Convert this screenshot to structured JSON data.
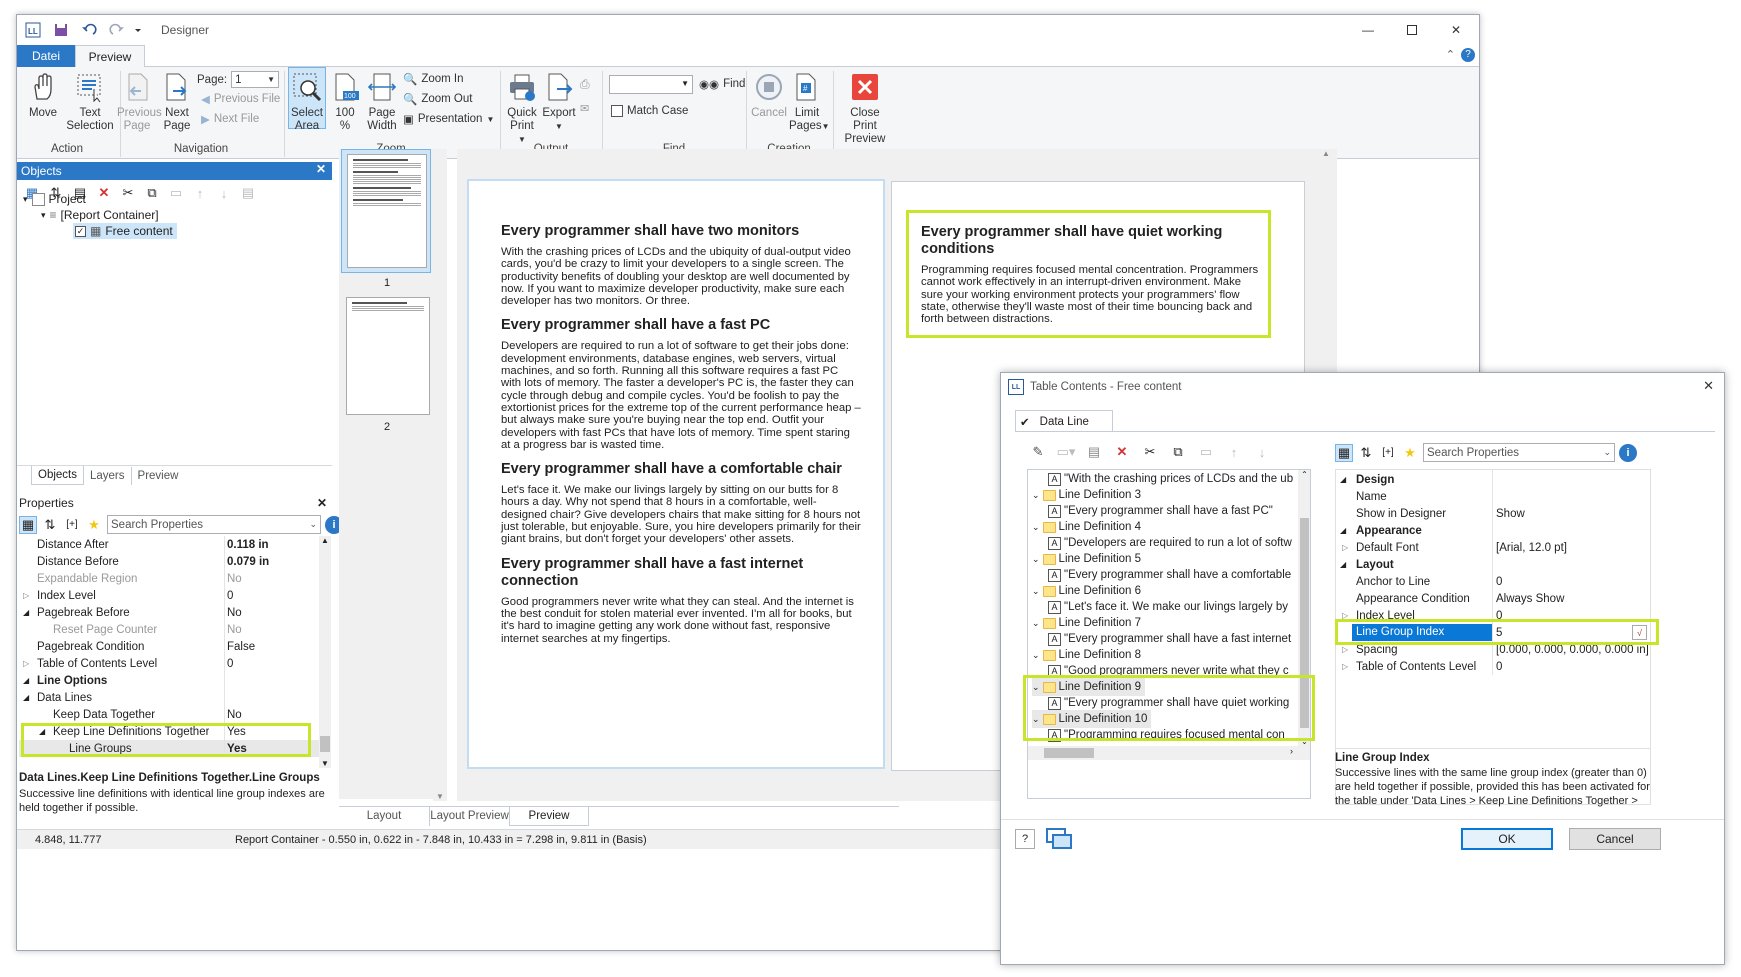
{
  "window": {
    "title": "Designer"
  },
  "tabs": {
    "file": "Datei",
    "preview": "Preview"
  },
  "ribbon": {
    "move": "Move",
    "text_selection_1": "Text",
    "text_selection_2": "Selection",
    "previous_page_1": "Previous",
    "previous_page_2": "Page",
    "next_page_1": "Next",
    "next_page_2": "Page",
    "page_label": "Page:",
    "page_value": "1",
    "previous_file": "Previous File",
    "next_file": "Next File",
    "select_area_1": "Select",
    "select_area_2": "Area",
    "zoom_100_1": "100",
    "zoom_100_2": "%",
    "page_width_1": "Page",
    "page_width_2": "Width",
    "zoom_in": "Zoom In",
    "zoom_out": "Zoom Out",
    "presentation": "Presentation",
    "quick_print_1": "Quick",
    "quick_print_2": "Print",
    "export": "Export",
    "find": "Find",
    "match_case": "Match Case",
    "cancel": "Cancel",
    "limit_pages_1": "Limit",
    "limit_pages_2": "Pages",
    "close_preview_1": "Close Print",
    "close_preview_2": "Preview",
    "groups": {
      "action": "Action",
      "navigation": "Navigation",
      "zoom": "Zoom",
      "output": "Output",
      "find": "Find",
      "creation": "Creation"
    }
  },
  "objects_panel": {
    "title": "Objects",
    "tree": {
      "project": "Project",
      "container": "[Report Container]",
      "free_content": "Free content"
    },
    "bottom_tabs": {
      "objects": "Objects",
      "layers": "Layers",
      "preview": "Preview"
    }
  },
  "properties": {
    "title": "Properties",
    "search_placeholder": "Search Properties",
    "rows": [
      {
        "name": "Distance After",
        "value": "0.118 in"
      },
      {
        "name": "Distance Before",
        "value": "0.079 in"
      },
      {
        "name": "Expandable Region",
        "value": "No"
      },
      {
        "name": "Index Level",
        "value": "0"
      },
      {
        "name": "Pagebreak Before",
        "value": "No"
      },
      {
        "name": "Reset Page Counter",
        "value": "No"
      },
      {
        "name": "Pagebreak Condition",
        "value": "False"
      },
      {
        "name": "Table of Contents Level",
        "value": "0"
      },
      {
        "name": "Line Options",
        "value": ""
      },
      {
        "name": "Data Lines",
        "value": ""
      },
      {
        "name": "Keep Data Together",
        "value": "No"
      },
      {
        "name": "Keep Line Definitions Together",
        "value": "Yes"
      },
      {
        "name": "Line Groups",
        "value": "Yes"
      }
    ],
    "help_title": "Data Lines.Keep Line Definitions Together.Line Groups",
    "help_text": "Successive line definitions with identical line group indexes are held together if possible."
  },
  "thumbnails": {
    "page1": "1",
    "page2": "2"
  },
  "preview_tabs": {
    "layout": "Layout",
    "layout_preview": "Layout Preview",
    "preview": "Preview"
  },
  "document": {
    "page1": [
      {
        "heading": "Every programmer shall have two monitors",
        "text": "With the crashing prices of LCDs and the ubiquity of dual-output video cards, you'd be crazy to limit your developers to a single screen. The productivity benefits of doubling your desktop are well documented by now. If you want to maximize developer productivity, make sure each developer has two monitors. Or three."
      },
      {
        "heading": "Every programmer shall have a fast PC",
        "text": "Developers are required to run a lot of software to get their jobs done: development environments, database engines, web servers, virtual machines, and so forth. Running all this software requires a fast PC with lots of memory. The faster a developer's PC is, the faster they can cycle through debug and compile cycles. You'd be foolish to pay the extortionist prices for the extreme top of the current performance heap – but always make sure you're buying near the top end. Outfit your developers with fast PCs that have lots of memory. Time spent staring at a progress bar is wasted time."
      },
      {
        "heading": "Every programmer shall have a comfortable chair",
        "text": "Let's face it. We make our livings largely by sitting on our butts for 8 hours a day. Why not spend that 8 hours in a comfortable, well-designed chair? Give developers chairs that make sitting for 8 hours not just tolerable, but enjoyable. Sure, you hire developers primarily for their giant brains, but don't forget your developers' other assets."
      },
      {
        "heading": "Every programmer shall have a fast internet connection",
        "text": "Good programmers never write what they can steal. And the internet is the best conduit for stolen material ever invented. I'm all for books, but it's hard to imagine getting any work done without fast, responsive internet searches at my fingertips."
      }
    ],
    "page2": {
      "heading": "Every programmer shall have quiet working conditions",
      "text": "Programming requires focused mental concentration. Programmers cannot work effectively in an interrupt-driven environment. Make sure your working environment protects your programmers' flow state, otherwise they'll waste most of their time bouncing back and forth between distractions."
    }
  },
  "status_bar": {
    "coords": "4.848, 11.777",
    "info": "Report Container  -  0.550 in, 0.622 in  -  7.848 in, 10.433 in  =  7.298 in, 9.811 in (Basis)"
  },
  "dialog": {
    "title": "Table Contents - Free content",
    "tab": "Data Line",
    "tree": [
      {
        "type": "text",
        "label": "\"With the crashing prices of LCDs and the ub"
      },
      {
        "type": "def",
        "label": "Line Definition  3"
      },
      {
        "type": "text",
        "label": "\"Every programmer shall have a fast PC\""
      },
      {
        "type": "def",
        "label": "Line Definition  4"
      },
      {
        "type": "text",
        "label": "\"Developers are required to run a lot of softw"
      },
      {
        "type": "def",
        "label": "Line Definition  5"
      },
      {
        "type": "text",
        "label": "\"Every programmer shall have a comfortable"
      },
      {
        "type": "def",
        "label": "Line Definition  6"
      },
      {
        "type": "text",
        "label": "\"Let's face it. We make our livings largely by"
      },
      {
        "type": "def",
        "label": "Line Definition  7"
      },
      {
        "type": "text",
        "label": "\"Every programmer shall have a fast internet"
      },
      {
        "type": "def",
        "label": "Line Definition  8"
      },
      {
        "type": "text",
        "label": "\"Good programmers never write what they c"
      },
      {
        "type": "def",
        "label": "Line Definition  9"
      },
      {
        "type": "text",
        "label": "\"Every programmer shall have quiet working"
      },
      {
        "type": "def",
        "label": "Line Definition 10"
      },
      {
        "type": "text",
        "label": "\"Programming requires focused mental con"
      }
    ],
    "search_placeholder": "Search Properties",
    "props": [
      {
        "name": "Design",
        "value": "",
        "cat": true
      },
      {
        "name": "Name",
        "value": ""
      },
      {
        "name": "Show in Designer",
        "value": "Show"
      },
      {
        "name": "Appearance",
        "value": "",
        "cat": true
      },
      {
        "name": "Default Font",
        "value": "[Arial, 12.0 pt]"
      },
      {
        "name": "Layout",
        "value": "",
        "cat": true
      },
      {
        "name": "Anchor to Line",
        "value": "0"
      },
      {
        "name": "Appearance Condition",
        "value": "Always Show"
      },
      {
        "name": "Index Level",
        "value": "0"
      },
      {
        "name": "Line Group Index",
        "value": "5"
      },
      {
        "name": "Spacing",
        "value": "[0.000, 0.000, 0.000, 0.000 in]"
      },
      {
        "name": "Table of Contents Level",
        "value": "0"
      }
    ],
    "help_title": "Line Group Index",
    "help_text": "Successive lines with the same line group index (greater than 0) are held together if possible, provided this has been activated for the table under 'Data Lines > Keep Line Definitions Together >",
    "ok": "OK",
    "cancel": "Cancel"
  },
  "colors": {
    "accent": "#2b78c6",
    "highlight": "#c8e629",
    "selection": "#cde5f8"
  }
}
